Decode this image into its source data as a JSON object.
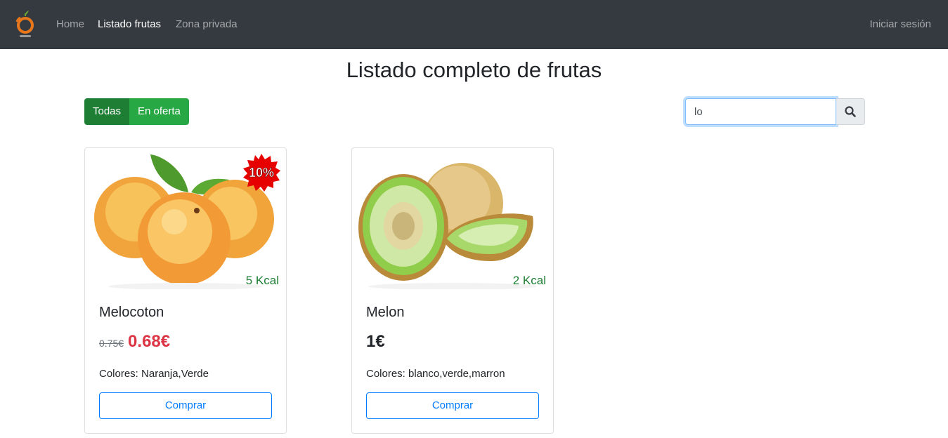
{
  "navbar": {
    "links": [
      {
        "label": "Home",
        "active": false
      },
      {
        "label": "Listado frutas",
        "active": true
      },
      {
        "label": "Zona privada",
        "active": false
      }
    ],
    "login_label": "Iniciar sesión"
  },
  "page": {
    "title": "Listado completo de frutas"
  },
  "filters": {
    "all_label": "Todas",
    "offer_label": "En oferta",
    "selected": "Todas"
  },
  "search": {
    "value": "lo",
    "placeholder": "",
    "icon": "search-icon"
  },
  "products": [
    {
      "name": "Melocoton",
      "kcal": "5 Kcal",
      "discount": "10%",
      "old_price": "0.75€",
      "price": "0.68€",
      "colors": "Colores: Naranja,Verde",
      "buy_label": "Comprar",
      "image": "peach-image"
    },
    {
      "name": "Melon",
      "kcal": "2 Kcal",
      "price": "1€",
      "colors": "Colores: blanco,verde,marron",
      "buy_label": "Comprar",
      "image": "melon-image"
    }
  ],
  "colors": {
    "navbar_bg": "#343a40",
    "filter_active": "#1e7e34",
    "filter_inactive": "#28a745",
    "price_red": "#dc3545",
    "kcal_green": "#1e7e34",
    "link_blue": "#007bff"
  }
}
